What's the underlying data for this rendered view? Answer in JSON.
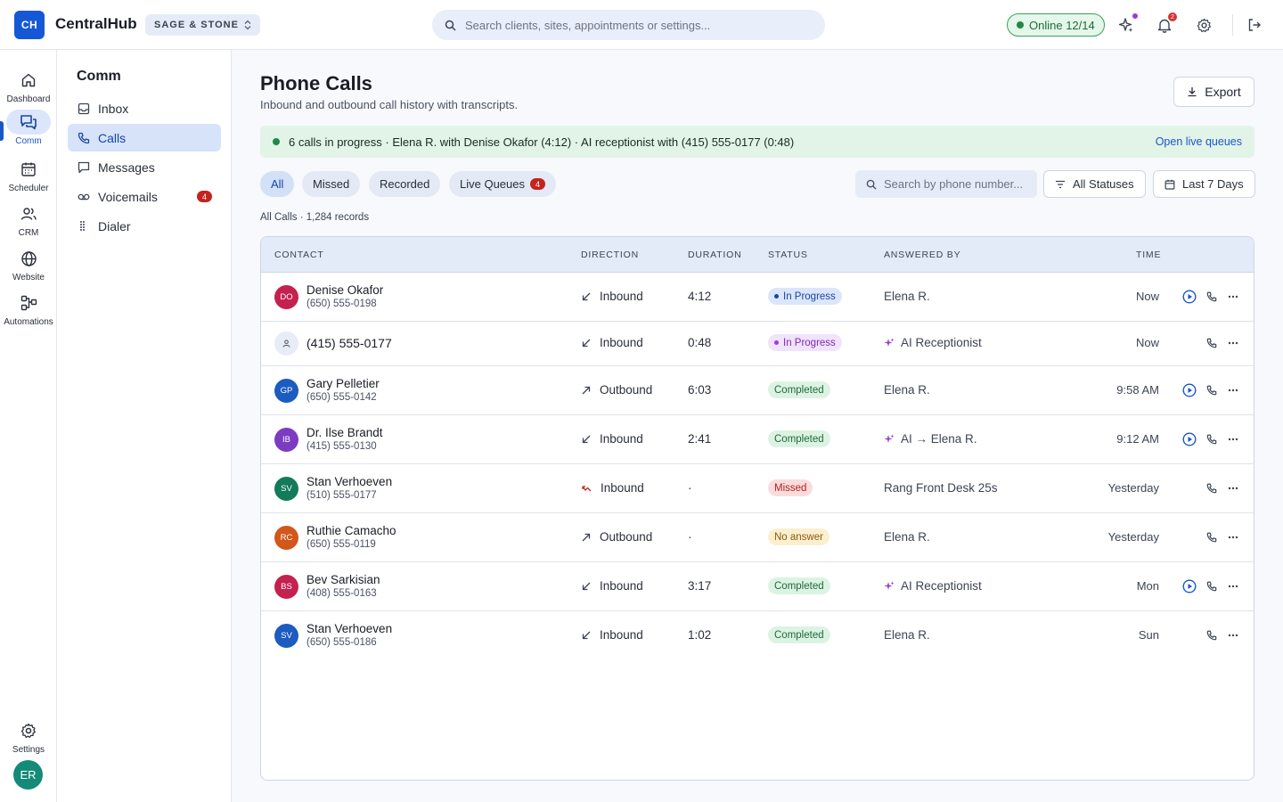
{
  "app": {
    "logo": "CH",
    "name": "CentralHub",
    "org": "SAGE & STONE"
  },
  "topbar": {
    "search_placeholder": "Search clients, sites, appointments or settings...",
    "online": "Online 12/14",
    "notification_count": "2"
  },
  "rail": {
    "items": [
      {
        "label": "Dashboard",
        "icon": "home-icon"
      },
      {
        "label": "Comm",
        "icon": "chat-icon"
      },
      {
        "label": "Scheduler",
        "icon": "calendar-icon"
      },
      {
        "label": "CRM",
        "icon": "users-icon"
      },
      {
        "label": "Website",
        "icon": "globe-icon"
      },
      {
        "label": "Automations",
        "icon": "workflow-icon"
      }
    ],
    "settings_label": "Settings",
    "user_initials": "ER"
  },
  "subnav": {
    "title": "Comm",
    "items": [
      {
        "label": "Inbox",
        "icon": "inbox-icon"
      },
      {
        "label": "Calls",
        "icon": "phone-icon"
      },
      {
        "label": "Messages",
        "icon": "message-icon"
      },
      {
        "label": "Voicemails",
        "icon": "voicemail-icon",
        "badge": "4"
      },
      {
        "label": "Dialer",
        "icon": "dialpad-icon"
      }
    ]
  },
  "page": {
    "title": "Phone Calls",
    "subtitle": "Inbound and outbound call history with transcripts.",
    "export_label": "Export"
  },
  "banner": {
    "text": "6 calls in progress · Elena R. with Denise Okafor (4:12) · AI receptionist with (415) 555-0177 (0:48)",
    "link": "Open live queues"
  },
  "filters": {
    "chips": [
      "All",
      "Missed",
      "Recorded",
      "Live Queues"
    ],
    "live_queues_count": "4",
    "search_placeholder": "Search by phone number...",
    "status_filter": "All Statuses",
    "date_filter": "Last 7 Days"
  },
  "records_label": "All Calls · 1,284 records",
  "table": {
    "columns": [
      "CONTACT",
      "DIRECTION",
      "DURATION",
      "STATUS",
      "ANSWERED BY",
      "TIME"
    ],
    "rows": [
      {
        "initials": "DO",
        "name": "Denise Okafor",
        "phone": "(650) 555-0198",
        "direction": "Inbound",
        "duration": "4:12",
        "status": "In Progress",
        "answered": "Elena R.",
        "time": "Now"
      },
      {
        "initials": "",
        "name": "(415) 555-0177",
        "phone": "",
        "direction": "Inbound",
        "duration": "0:48",
        "status": "In Progress",
        "answered": "AI Receptionist",
        "time": "Now"
      },
      {
        "initials": "GP",
        "name": "Gary Pelletier",
        "phone": "(650) 555-0142",
        "direction": "Outbound",
        "duration": "6:03",
        "status": "Completed",
        "answered": "Elena R.",
        "time": "9:58 AM"
      },
      {
        "initials": "IB",
        "name": "Dr. Ilse Brandt",
        "phone": "(415) 555-0130",
        "direction": "Inbound",
        "duration": "2:41",
        "status": "Completed",
        "answered": "AI → Elena R.",
        "time": "9:12 AM"
      },
      {
        "initials": "SV",
        "name": "Stan Verhoeven",
        "phone": "(510) 555-0177",
        "direction": "Inbound",
        "duration": "·",
        "status": "Missed",
        "answered": "Rang Front Desk 25s",
        "time": "Yesterday"
      },
      {
        "initials": "RC",
        "name": "Ruthie Camacho",
        "phone": "(650) 555-0119",
        "direction": "Outbound",
        "duration": "·",
        "status": "No answer",
        "answered": "Elena R.",
        "time": "Yesterday"
      },
      {
        "initials": "BS",
        "name": "Bev Sarkisian",
        "phone": "(408) 555-0163",
        "direction": "Inbound",
        "duration": "3:17",
        "status": "Completed",
        "answered": "AI Receptionist",
        "time": "Mon"
      },
      {
        "initials": "SV",
        "name": "Stan Verhoeven",
        "phone": "(650) 555-0186",
        "direction": "Inbound",
        "duration": "1:02",
        "status": "Completed",
        "answered": "Elena R.",
        "time": "Sun"
      }
    ]
  },
  "colors": {
    "accent": "#1a56c9",
    "live_green": "#1e8a46",
    "badge_red": "#c4231f",
    "ai_purple": "#9b3bd8"
  }
}
